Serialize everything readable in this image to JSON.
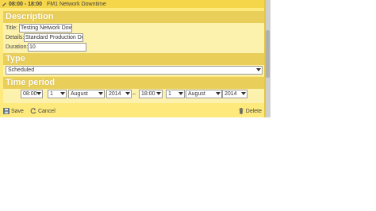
{
  "titlebar": {
    "time": "08:00 - 18:00",
    "name": "FM1 Network Downtime"
  },
  "description": {
    "heading": "Description",
    "title_label": "Title:",
    "title_value": "Testing Network Downtime",
    "details_label": "Details:",
    "details_value": "Standard Production Downtime",
    "duration_label": "Duration:",
    "duration_value": "10"
  },
  "type": {
    "heading": "Type",
    "selected": "Scheduled"
  },
  "time_period": {
    "heading": "Time period",
    "start": {
      "time": "08:00",
      "day": "1",
      "month": "August",
      "year": "2014"
    },
    "separator": "–",
    "end": {
      "time": "18:00",
      "day": "1",
      "month": "August",
      "year": "2014"
    }
  },
  "footer": {
    "save_label": "Save",
    "cancel_label": "Cancel",
    "delete_label": "Delete"
  },
  "colors": {
    "panel": "#fde97c",
    "header": "#e9cf5a",
    "body": "#fdf2ad",
    "titlebar": "#f5d54a"
  }
}
